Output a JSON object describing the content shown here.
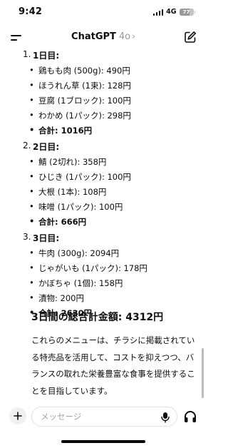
{
  "status_bar": {
    "time": "9:42",
    "network": "4G",
    "battery": "77"
  },
  "header": {
    "title": "ChatGPT",
    "model": "4o",
    "chevron": "›"
  },
  "menu": {
    "days": [
      {
        "num": "1.",
        "label": "1日目:",
        "items": [
          "鶏もも肉 (500g): 490円",
          "ほうれん草 (1束): 128円",
          "豆腐 (1ブロック): 100円",
          "わかめ (1パック): 298円"
        ],
        "total": "合計: 1016円"
      },
      {
        "num": "2.",
        "label": "2日目:",
        "items": [
          "鯖 (2切れ): 358円",
          "ひじき (1パック): 100円",
          "大根 (1本): 108円",
          "味噌 (1パック): 100円"
        ],
        "total": "合計: 666円"
      },
      {
        "num": "3.",
        "label": "3日目:",
        "items": [
          "牛肉 (300g): 2094円",
          "じゃがいも (1パック): 178円",
          "かぼちゃ (1個): 158円",
          "漬物: 200円"
        ],
        "total": "合計: 2630円"
      }
    ],
    "bullet": "•",
    "summary": "3日間の総合計金額: 4312円",
    "paragraph": "これらのメニューは、チラシに掲載されている特売品を活用して、コストを抑えつつ、バランスの取れた栄養豊富な食事を提供することを目指しています。"
  },
  "composer": {
    "placeholder": "メッセージ"
  },
  "icons": {
    "menu": "menu-icon",
    "new_chat": "new-chat-icon",
    "plus": "plus-icon",
    "mic": "mic-icon",
    "headphones": "headphones-icon",
    "signal": "signal-icon",
    "battery": "battery-icon"
  }
}
